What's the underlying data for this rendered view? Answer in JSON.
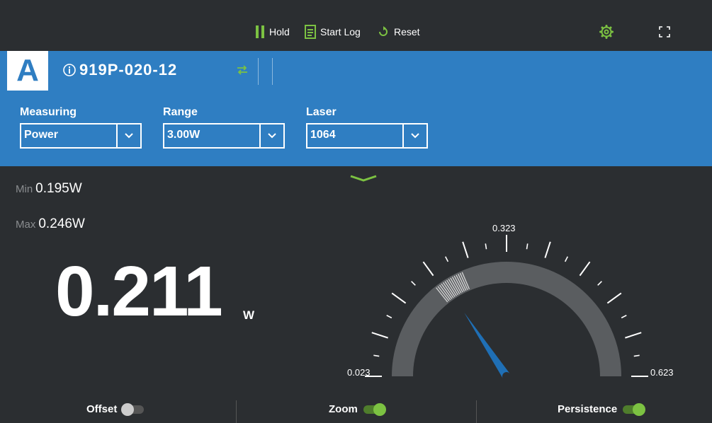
{
  "toolbar": {
    "hold_label": "Hold",
    "start_log_label": "Start Log",
    "reset_label": "Reset",
    "settings_icon": "gear-icon",
    "fullscreen_icon": "fullscreen-icon"
  },
  "channel": {
    "letter": "A",
    "info_icon": "info-icon",
    "model": "919P-020-12",
    "swap_icon": "swap-icon"
  },
  "selectors": {
    "measuring": {
      "label": "Measuring",
      "value": "Power"
    },
    "range": {
      "label": "Range",
      "value": "3.00W"
    },
    "laser": {
      "label": "Laser",
      "value": "1064"
    }
  },
  "stats": {
    "min_label": "Min",
    "min_value": "0.195W",
    "max_label": "Max",
    "max_value": "0.246W"
  },
  "reading": {
    "value": "0.211",
    "unit": "W"
  },
  "gauge": {
    "min_label": "0.023",
    "mid_label": "0.323",
    "max_label": "0.623",
    "min": 0.023,
    "max": 0.623,
    "needle_value": 0.211,
    "persistence_min": 0.195,
    "persistence_max": 0.246
  },
  "bottom": {
    "offset_label": "Offset",
    "offset_on": false,
    "zoom_label": "Zoom",
    "zoom_on": true,
    "persistence_label": "Persistence",
    "persistence_on": true
  },
  "colors": {
    "accent_green": "#7cc242",
    "header_blue": "#2f7ec2",
    "background": "#2b2e31",
    "needle_blue": "#1f6fb5",
    "arc_gray": "#5a5d60"
  }
}
